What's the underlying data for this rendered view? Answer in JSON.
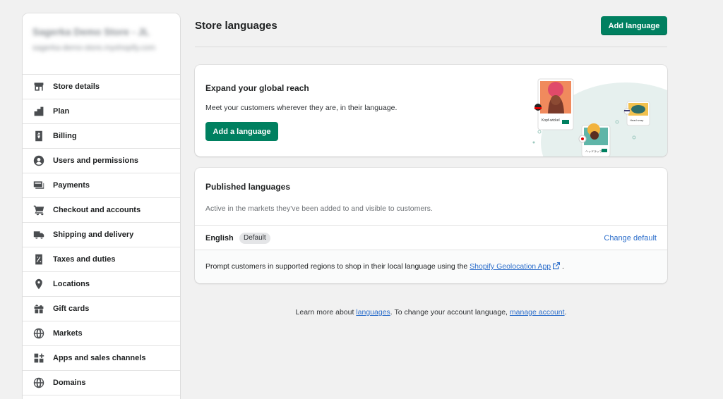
{
  "sidebar": {
    "store_name": "Sagerka Demo Store - JL",
    "store_sub": "sagerka-demo-store.myshopify.com",
    "items": [
      {
        "label": "Store details",
        "icon": "store-icon"
      },
      {
        "label": "Plan",
        "icon": "plan-icon"
      },
      {
        "label": "Billing",
        "icon": "billing-icon"
      },
      {
        "label": "Users and permissions",
        "icon": "user-icon"
      },
      {
        "label": "Payments",
        "icon": "payments-icon"
      },
      {
        "label": "Checkout and accounts",
        "icon": "cart-icon"
      },
      {
        "label": "Shipping and delivery",
        "icon": "truck-icon"
      },
      {
        "label": "Taxes and duties",
        "icon": "tax-icon"
      },
      {
        "label": "Locations",
        "icon": "location-pin-icon"
      },
      {
        "label": "Gift cards",
        "icon": "gift-icon"
      },
      {
        "label": "Markets",
        "icon": "globe-icon"
      },
      {
        "label": "Apps and sales channels",
        "icon": "apps-icon"
      },
      {
        "label": "Domains",
        "icon": "domain-globe-icon"
      }
    ]
  },
  "header": {
    "title": "Store languages",
    "add_language_button": "Add language"
  },
  "reach_card": {
    "title": "Expand your global reach",
    "text": "Meet your customers wherever they are, in their language.",
    "button": "Add a language",
    "illustration_labels": {
      "card1": "Kopf-wickel",
      "card2": "ヘッドラップ",
      "card3": "Head wrap"
    }
  },
  "published_card": {
    "title": "Published languages",
    "subtitle": "Active in the markets they've been added to and visible to customers.",
    "language": "English",
    "badge": "Default",
    "change_default": "Change default",
    "prompt_before": "Prompt customers in supported regions to shop in their local language using the ",
    "prompt_link": "Shopify Geolocation App",
    "prompt_after": " ."
  },
  "footer": {
    "before": "Learn more about ",
    "link1": "languages",
    "middle": ". To change your account language, ",
    "link2": "manage account",
    "after": "."
  },
  "colors": {
    "primary": "#008060",
    "link": "#2c6ecb",
    "background": "#f1f1f1"
  }
}
